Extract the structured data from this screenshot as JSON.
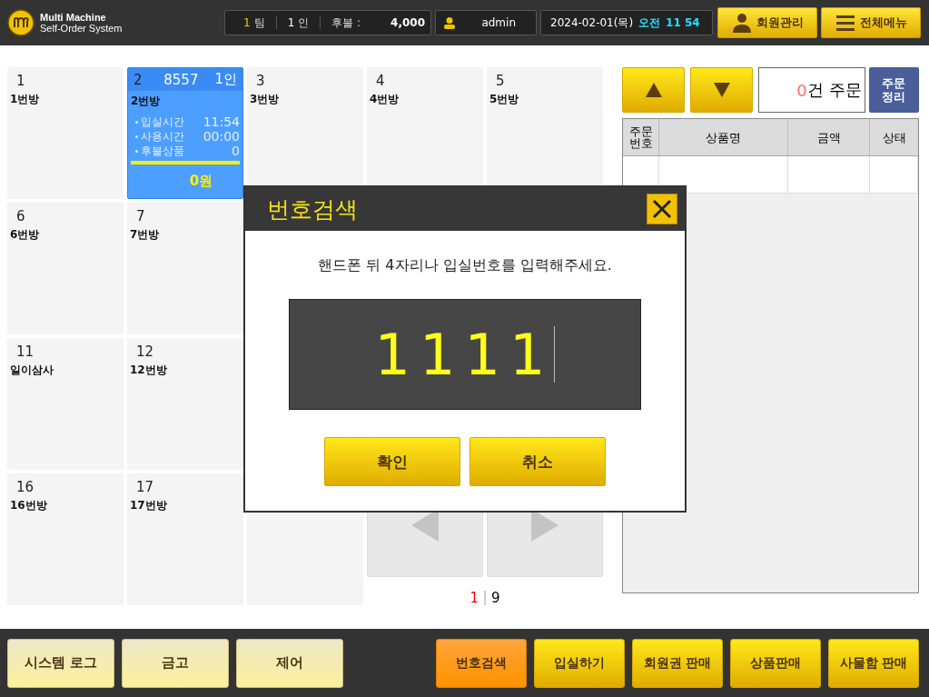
{
  "header": {
    "logo_title": "Multi Machine",
    "logo_subtitle": "Self-Order System",
    "status": {
      "team": "1",
      "team_unit": "팀",
      "people": "1",
      "people_unit": "인",
      "deferred_label": "후불 :",
      "deferred_amount": "4,000"
    },
    "user": "admin",
    "date": "2024-02-01(목)",
    "ampm": "오전",
    "time": "11 54",
    "buttons": [
      {
        "label": "회원관리",
        "kind": "person"
      },
      {
        "label": "전체메뉴",
        "kind": "menu"
      }
    ]
  },
  "rooms": [
    {
      "kind": "room",
      "number": "1",
      "name": "1번방"
    },
    {
      "kind": "occupied",
      "number": "2",
      "code": "8557",
      "people": "1인",
      "name": "2번방",
      "info": [
        {
          "label": "입실시간",
          "value": "11:54"
        },
        {
          "label": "사용시간",
          "value": "00:00"
        },
        {
          "label": "후불상품",
          "value": "0"
        }
      ],
      "total": "0원"
    },
    {
      "kind": "room",
      "number": "3",
      "name": "3번방"
    },
    {
      "kind": "room",
      "number": "4",
      "name": "4번방"
    },
    {
      "kind": "room",
      "number": "5",
      "name": "5번방"
    },
    {
      "kind": "room",
      "number": "6",
      "name": "6번방"
    },
    {
      "kind": "room",
      "number": "7",
      "name": "7번방"
    },
    {
      "kind": "hidden"
    },
    {
      "kind": "hidden"
    },
    {
      "kind": "hidden"
    },
    {
      "kind": "room",
      "number": "11",
      "name": "일이삼사"
    },
    {
      "kind": "room",
      "number": "12",
      "name": "12번방"
    },
    {
      "kind": "hidden"
    },
    {
      "kind": "hidden"
    },
    {
      "kind": "hidden"
    },
    {
      "kind": "room",
      "number": "16",
      "name": "16번방"
    },
    {
      "kind": "room",
      "number": "17",
      "name": "17번방"
    },
    {
      "kind": "hidden"
    },
    {
      "kind": "pager"
    }
  ],
  "pager": {
    "current": "1",
    "total": "9"
  },
  "orders": {
    "count": "0",
    "count_suffix": "건 주문",
    "clear_button": "주문 정리",
    "columns": [
      "주문 번호",
      "상품명",
      "금액",
      "상태"
    ]
  },
  "dialog": {
    "title": "번호검색",
    "message": "핸드폰 뒤 4자리나 입실번호를 입력해주세요.",
    "value": "1111",
    "buttons": [
      "확인",
      "취소"
    ]
  },
  "footer": {
    "left_buttons": [
      "시스템 로그",
      "금고",
      "제어"
    ],
    "right_buttons": [
      {
        "label": "번호검색",
        "selected": true
      },
      {
        "label": "입실하기",
        "selected": false
      },
      {
        "label": "회원권 판매",
        "selected": false
      },
      {
        "label": "상품판매",
        "selected": false
      },
      {
        "label": "사물함 판매",
        "selected": false
      }
    ]
  }
}
